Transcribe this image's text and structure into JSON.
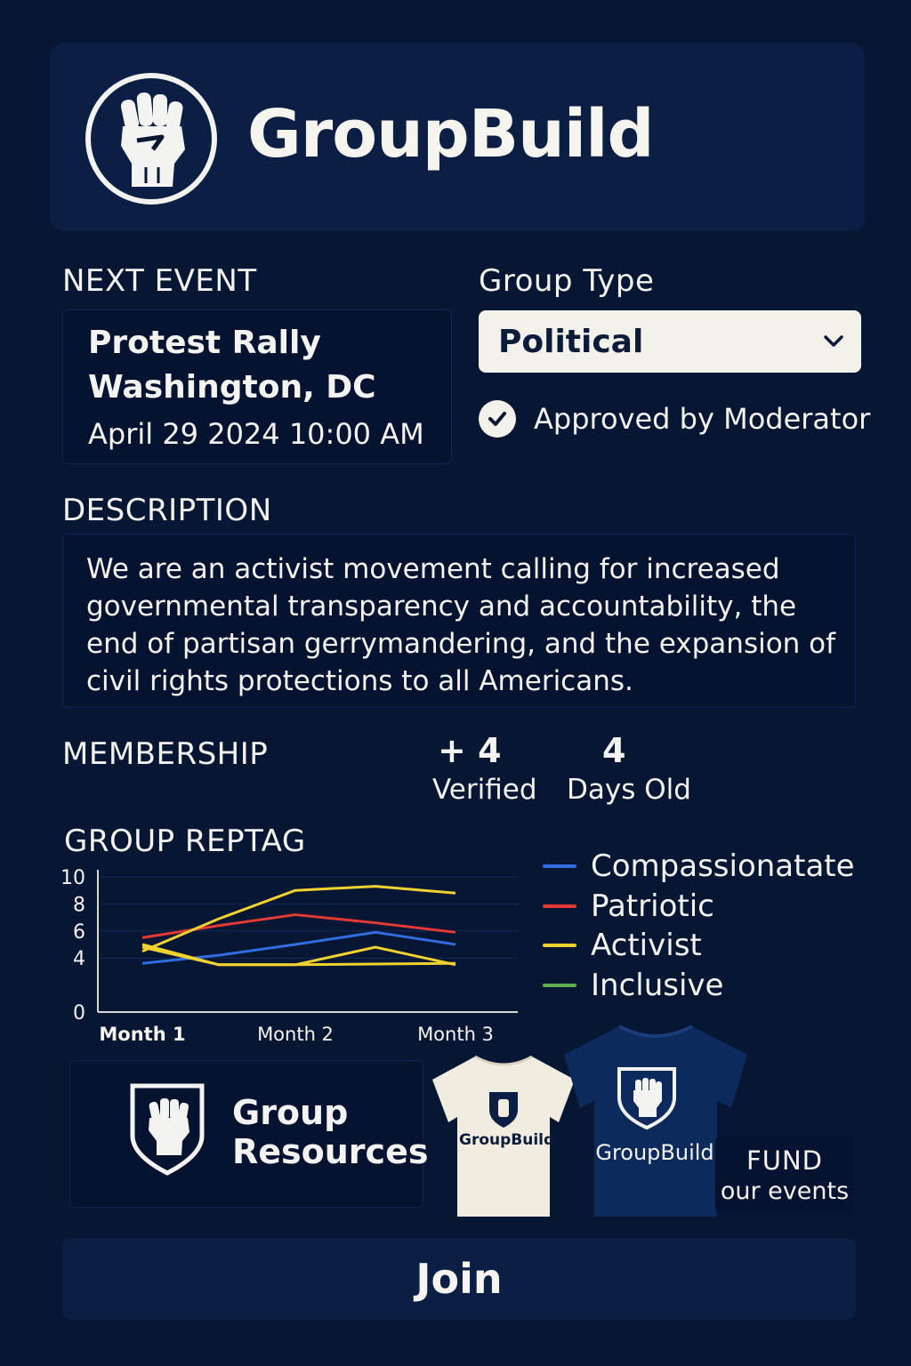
{
  "app": {
    "name": "GroupBuild"
  },
  "next_event": {
    "label": "NEXT EVENT",
    "title_line1": "Protest Rally",
    "title_line2": "Washington, DC",
    "datetime": "April 29 2024 10:00 AM"
  },
  "group_type": {
    "label": "Group Type",
    "selected": "Political",
    "approval": "Approved by Moderator"
  },
  "description": {
    "label": "DESCRIPTION",
    "text": "We are an activist movement calling for increased governmental transparency and accountability, the end of partisan gerrymandering, and the expansion of civil rights protections to all Americans."
  },
  "membership": {
    "label": "MEMBERSHIP",
    "verified_value": "+ 4",
    "verified_label": "Verified",
    "age_value": "4",
    "age_label": "Days Old"
  },
  "reptag": {
    "label": "GROUP REPTAG"
  },
  "chart_data": {
    "type": "line",
    "title": "GROUP REPTAG",
    "categories": [
      "Month 1",
      "Month 2",
      "Month 3"
    ],
    "y_ticks": [
      0,
      4,
      6,
      8,
      10
    ],
    "ylim": [
      0,
      10
    ],
    "legend_position": "right",
    "series": [
      {
        "name": "Compassionatate",
        "color": "#2f6de0",
        "points": [
          [
            1,
            3.6
          ],
          [
            1.5,
            4.2
          ],
          [
            2,
            5.0
          ],
          [
            2.5,
            5.9
          ],
          [
            3,
            5.0
          ]
        ]
      },
      {
        "name": "Patriotic",
        "color": "#e53935",
        "points": [
          [
            1,
            5.5
          ],
          [
            1.5,
            6.4
          ],
          [
            2,
            7.2
          ],
          [
            2.5,
            6.6
          ],
          [
            3,
            5.9
          ]
        ]
      },
      {
        "name": "Activist",
        "color": "#f2d230",
        "points": [
          [
            1,
            4.5
          ],
          [
            1.5,
            6.9
          ],
          [
            2,
            9.0
          ],
          [
            2.5,
            9.3
          ],
          [
            3,
            8.8
          ]
        ]
      },
      {
        "name": "",
        "color": "#f2d230",
        "points": [
          [
            1,
            5.0
          ],
          [
            1.5,
            3.5
          ],
          [
            2,
            3.5
          ],
          [
            2.5,
            4.8
          ],
          [
            3,
            3.5
          ]
        ]
      },
      {
        "name": "",
        "color": "#f2d230",
        "points": [
          [
            1,
            4.8
          ],
          [
            1.5,
            3.5
          ],
          [
            2,
            3.5
          ],
          [
            2.5,
            3.55
          ],
          [
            3,
            3.6
          ]
        ]
      },
      {
        "name": "Inclusive",
        "color": "#5fae4a",
        "points": []
      }
    ]
  },
  "resources": {
    "line1": "Group",
    "line2": "Resources",
    "shirt_light_text": "GroupBuild",
    "shirt_dark_text": "GroupBuild",
    "fund_line1": "FUND",
    "fund_line2": "our events"
  },
  "join_label": "Join"
}
